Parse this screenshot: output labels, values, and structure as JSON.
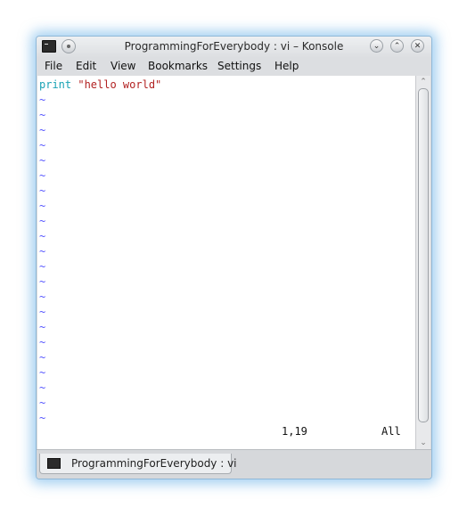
{
  "window": {
    "title": "ProgrammingForEverybody : vi – Konsole",
    "controls": {
      "minimize": "⌄",
      "maximize": "⌃",
      "close": "✕"
    }
  },
  "menu": {
    "items": [
      "File",
      "Edit",
      "View",
      "Bookmarks",
      "Settings",
      "Help"
    ]
  },
  "editor": {
    "line_keyword": "print",
    "line_string": "\"hello world\"",
    "empty_line_marker": "~",
    "empty_line_count": 22,
    "cursor_position": "1,19",
    "scroll_indicator": "All"
  },
  "scrollbar": {
    "up_arrow": "⌃",
    "down_arrow": "⌄"
  },
  "tabs": [
    {
      "label": "ProgrammingForEverybody : vi",
      "icon": "terminal-icon"
    }
  ],
  "colors": {
    "keyword": "#1aa3b5",
    "string": "#b22222",
    "tilde": "#5555ff",
    "window_glow": "#5aaae6"
  }
}
